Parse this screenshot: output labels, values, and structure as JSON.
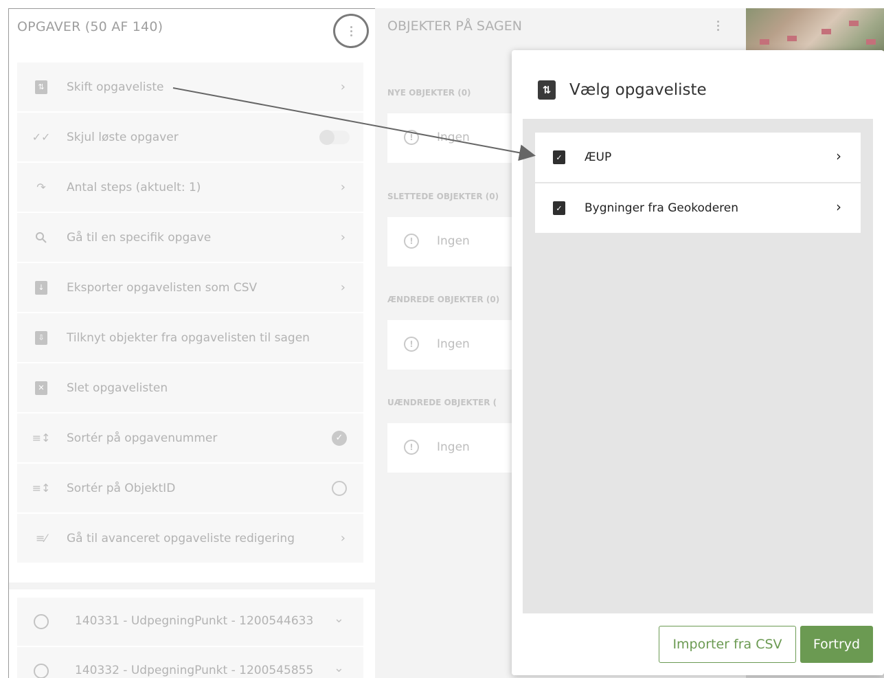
{
  "left_panel": {
    "title": "OPGAVER (50 AF 140)",
    "menu": [
      {
        "label": "Skift opgaveliste",
        "icon": "clipboard-swap-icon",
        "right": "›"
      },
      {
        "label": "Skjul løste opgaver",
        "icon": "double-check-icon",
        "right": "toggle"
      },
      {
        "label": "Antal steps (aktuelt: 1)",
        "icon": "redo-icon",
        "right": "›"
      },
      {
        "label": "Gå til en specifik opgave",
        "icon": "search-icon",
        "right": "›"
      },
      {
        "label": "Eksporter opgavelisten som CSV",
        "icon": "clipboard-export-icon",
        "right": "›"
      },
      {
        "label": "Tilknyt objekter fra opgavelisten til sagen",
        "icon": "download-box-icon",
        "right": ""
      },
      {
        "label": "Slet opgavelisten",
        "icon": "trash-icon",
        "right": ""
      },
      {
        "label": "Sortér på opgavenummer",
        "icon": "sort-icon",
        "right": "checked"
      },
      {
        "label": "Sortér på ObjektID",
        "icon": "sort-icon",
        "right": "unchecked"
      },
      {
        "label": "Gå til avanceret opgaveliste redigering",
        "icon": "list-edit-icon",
        "right": "›"
      }
    ],
    "tasks": [
      {
        "label": "140331 - UdpegningPunkt - 1200544633"
      },
      {
        "label": "140332 - UdpegningPunkt - 1200545855"
      }
    ]
  },
  "middle_panel": {
    "title": "OBJEKTER PÅ SAGEN",
    "sections": [
      {
        "label": "NYE OBJEKTER (0)",
        "value": "Ingen"
      },
      {
        "label": "SLETTEDE OBJEKTER (0)",
        "value": "Ingen"
      },
      {
        "label": "ÆNDREDE OBJEKTER (0)",
        "value": "Ingen"
      },
      {
        "label": "UÆNDREDE OBJEKTER (",
        "value": "Ingen"
      }
    ]
  },
  "dialog": {
    "title": "Vælg opgaveliste",
    "options": [
      {
        "label": "ÆUP"
      },
      {
        "label": "Bygninger fra Geokoderen"
      }
    ],
    "import_label": "Importer fra CSV",
    "cancel_label": "Fortryd"
  },
  "colors": {
    "accent_green": "#6b9a52",
    "annotation_circle": "#7a7a7a"
  }
}
